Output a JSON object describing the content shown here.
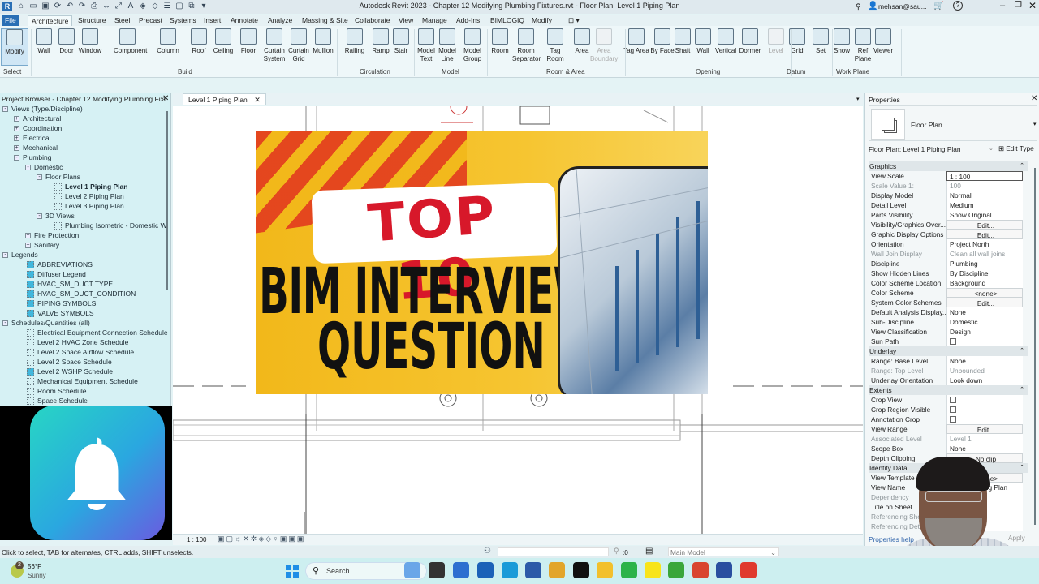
{
  "window": {
    "title": "Autodesk Revit 2023 - Chapter 12 Modifying Plumbing Fixtures.rvt - Floor Plan: Level 1 Piping Plan",
    "user": "mehsan@sau...",
    "help": "?"
  },
  "tabs": [
    "File",
    "Architecture",
    "Structure",
    "Steel",
    "Precast",
    "Systems",
    "Insert",
    "Annotate",
    "Analyze",
    "Massing & Site",
    "Collaborate",
    "View",
    "Manage",
    "Add-Ins",
    "BIMLOGIQ",
    "Modify"
  ],
  "active_tab": "Architecture",
  "ribbon": {
    "tools": [
      "Modify",
      "Wall",
      "Door",
      "Window",
      "Component",
      "Column",
      "Roof",
      "Ceiling",
      "Floor",
      "Curtain System",
      "Curtain Grid",
      "Mullion",
      "Railing",
      "Ramp",
      "Stair",
      "Model Text",
      "Model Line",
      "Model Group",
      "Room",
      "Room Separator",
      "Tag Room",
      "Area",
      "Area Boundary",
      "Tag Area",
      "By Face",
      "Shaft",
      "Wall",
      "Vertical",
      "Dormer",
      "Level",
      "Grid",
      "Set",
      "Show",
      "Ref Plane",
      "Viewer"
    ],
    "panels": [
      "Select",
      "Build",
      "Circulation",
      "Model",
      "Room & Area",
      "Opening",
      "Datum",
      "Work Plane"
    ]
  },
  "project_browser": {
    "title": "Project Browser - Chapter 12 Modifying Plumbing Fixt...",
    "items": [
      {
        "label": "Views (Type/Discipline)",
        "level": 0,
        "toggle": "-"
      },
      {
        "label": "Architectural",
        "level": 1,
        "toggle": "+"
      },
      {
        "label": "Coordination",
        "level": 1,
        "toggle": "+"
      },
      {
        "label": "Electrical",
        "level": 1,
        "toggle": "+"
      },
      {
        "label": "Mechanical",
        "level": 1,
        "toggle": "+"
      },
      {
        "label": "Plumbing",
        "level": 1,
        "toggle": "-"
      },
      {
        "label": "Domestic",
        "level": 2,
        "toggle": "-"
      },
      {
        "label": "Floor Plans",
        "level": 3,
        "toggle": "-"
      },
      {
        "label": "Level 1 Piping Plan",
        "level": 4,
        "view": true,
        "bold": true
      },
      {
        "label": "Level 2 Piping Plan",
        "level": 4,
        "view": true
      },
      {
        "label": "Level 3 Piping Plan",
        "level": 4,
        "view": true
      },
      {
        "label": "3D Views",
        "level": 3,
        "toggle": "-"
      },
      {
        "label": "Plumbing Isometric - Domestic W",
        "level": 4,
        "view": true
      },
      {
        "label": "Fire Protection",
        "level": 2,
        "toggle": "+"
      },
      {
        "label": "Sanitary",
        "level": 2,
        "toggle": "+"
      },
      {
        "label": "Legends",
        "level": 0,
        "toggle": "-"
      },
      {
        "label": "ABBREVIATIONS",
        "level": 5,
        "legend": true
      },
      {
        "label": "Diffuser Legend",
        "level": 5,
        "legend": true
      },
      {
        "label": "HVAC_SM_DUCT TYPE",
        "level": 5,
        "legend": true
      },
      {
        "label": "HVAC_SM_DUCT_CONDITION",
        "level": 5,
        "legend": true
      },
      {
        "label": "PIPING SYMBOLS",
        "level": 5,
        "legend": true
      },
      {
        "label": "VALVE SYMBOLS",
        "level": 5,
        "legend": true
      },
      {
        "label": "Schedules/Quantities (all)",
        "level": 0,
        "toggle": "-"
      },
      {
        "label": "Electrical Equipment Connection Schedule",
        "level": 5,
        "view": true
      },
      {
        "label": "Level 2 HVAC Zone Schedule",
        "level": 5,
        "view": true
      },
      {
        "label": "Level 2 Space Airflow Schedule",
        "level": 5,
        "view": true
      },
      {
        "label": "Level 2 Space Schedule",
        "level": 5,
        "view": true
      },
      {
        "label": "Level 2 WSHP Schedule",
        "level": 5,
        "legend": true
      },
      {
        "label": "Mechanical Equipment Schedule",
        "level": 5,
        "view": true
      },
      {
        "label": "Room Schedule",
        "level": 5,
        "view": true
      },
      {
        "label": "Space Schedule",
        "level": 5,
        "view": true
      }
    ]
  },
  "view_tab": {
    "label": "Level 1 Piping Plan"
  },
  "thumbnail": {
    "line1": "TOP 10",
    "line2": "BIM INTERVIEW",
    "line3": "QUESTION"
  },
  "properties": {
    "title": "Properties",
    "type": "Floor Plan",
    "selector": "Floor Plan: Level 1 Piping Plan",
    "edit_type": "Edit Type",
    "rows": [
      {
        "h": "Graphics"
      },
      {
        "k": "View Scale",
        "v": "1 : 100",
        "t": "inp"
      },
      {
        "k": "Scale Value   1:",
        "v": "100",
        "gray": true
      },
      {
        "k": "Display Model",
        "v": "Normal"
      },
      {
        "k": "Detail Level",
        "v": "Medium"
      },
      {
        "k": "Parts Visibility",
        "v": "Show Original"
      },
      {
        "k": "Visibility/Graphics Over...",
        "v": "Edit...",
        "t": "btn"
      },
      {
        "k": "Graphic Display Options",
        "v": "Edit...",
        "t": "btn"
      },
      {
        "k": "Orientation",
        "v": "Project North"
      },
      {
        "k": "Wall Join Display",
        "v": "Clean all wall joins",
        "gray": true
      },
      {
        "k": "Discipline",
        "v": "Plumbing"
      },
      {
        "k": "Show Hidden Lines",
        "v": "By Discipline"
      },
      {
        "k": "Color Scheme Location",
        "v": "Background"
      },
      {
        "k": "Color Scheme",
        "v": "<none>",
        "t": "btn"
      },
      {
        "k": "System Color Schemes",
        "v": "Edit...",
        "t": "btn"
      },
      {
        "k": "Default Analysis Display...",
        "v": "None"
      },
      {
        "k": "Sub-Discipline",
        "v": "Domestic"
      },
      {
        "k": "View Classification",
        "v": "Design"
      },
      {
        "k": "Sun Path",
        "t": "cb"
      },
      {
        "h": "Underlay"
      },
      {
        "k": "Range: Base Level",
        "v": "None"
      },
      {
        "k": "Range: Top Level",
        "v": "Unbounded",
        "gray": true
      },
      {
        "k": "Underlay Orientation",
        "v": "Look down"
      },
      {
        "h": "Extents"
      },
      {
        "k": "Crop View",
        "t": "cb"
      },
      {
        "k": "Crop Region Visible",
        "t": "cb"
      },
      {
        "k": "Annotation Crop",
        "t": "cb"
      },
      {
        "k": "View Range",
        "v": "Edit...",
        "t": "btn"
      },
      {
        "k": "Associated Level",
        "v": "Level 1",
        "gray": true
      },
      {
        "k": "Scope Box",
        "v": "None"
      },
      {
        "k": "Depth Clipping",
        "v": "No clip",
        "t": "btn"
      },
      {
        "h": "Identity Data"
      },
      {
        "k": "View Template",
        "v": "<None>",
        "t": "btn"
      },
      {
        "k": "View Name",
        "v": "Level 1 Piping Plan"
      },
      {
        "k": "Dependency",
        "gray": true
      },
      {
        "k": "Title on Sheet"
      },
      {
        "k": "Referencing Sheet",
        "gray": true
      },
      {
        "k": "Referencing Detail",
        "gray": true
      }
    ],
    "help_link": "Properties help",
    "apply": "Apply"
  },
  "view_control": {
    "scale": "1 : 100"
  },
  "status": {
    "message": "Click to select, TAB for alternates, CTRL adds, SHIFT unselects.",
    "selection_count": ":0",
    "model": "Main Model"
  },
  "taskbar": {
    "weather_temp": "56°F",
    "weather_desc": "Sunny",
    "weather_badge": "2",
    "search": "Search"
  }
}
